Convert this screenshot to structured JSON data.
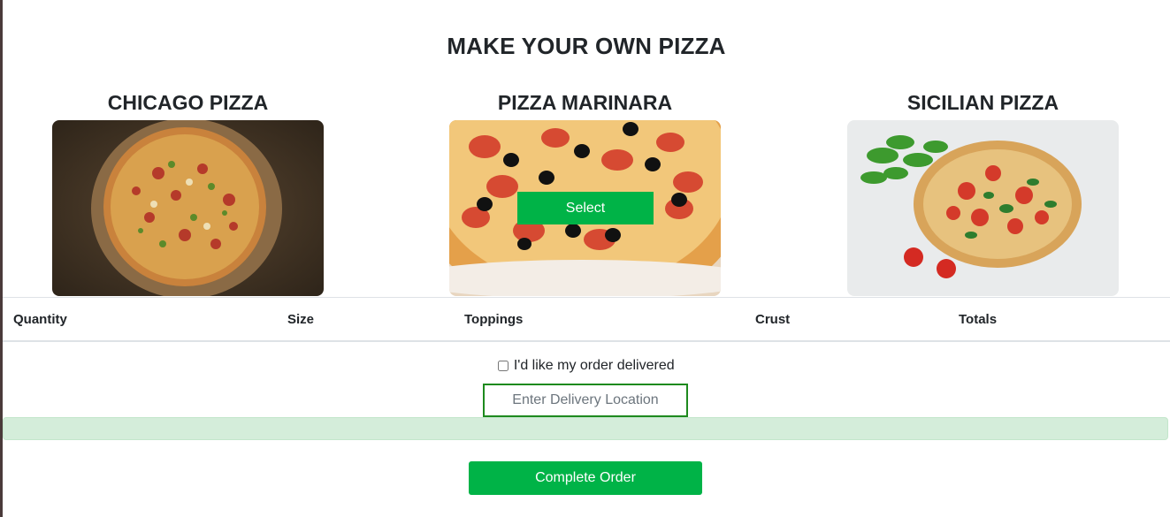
{
  "page": {
    "title": "MAKE YOUR OWN PIZZA"
  },
  "pizzas": [
    {
      "name": "CHICAGO PIZZA",
      "image": "chicago-pizza-photo"
    },
    {
      "name": "PIZZA MARINARA",
      "image": "marinara-pizza-photo",
      "select_label": "Select"
    },
    {
      "name": "SICILIAN PIZZA",
      "image": "sicilian-pizza-photo"
    }
  ],
  "order_table": {
    "headers": [
      "Quantity",
      "Size",
      "Toppings",
      "Crust",
      "Totals"
    ]
  },
  "delivery": {
    "checkbox_label": "I'd like my order delivered",
    "checked": false,
    "location_placeholder": "Enter Delivery Location"
  },
  "actions": {
    "complete_label": "Complete Order"
  },
  "colors": {
    "accent": "#00b347",
    "alert_bg": "#d4edda",
    "input_border": "#1e8a1e"
  }
}
